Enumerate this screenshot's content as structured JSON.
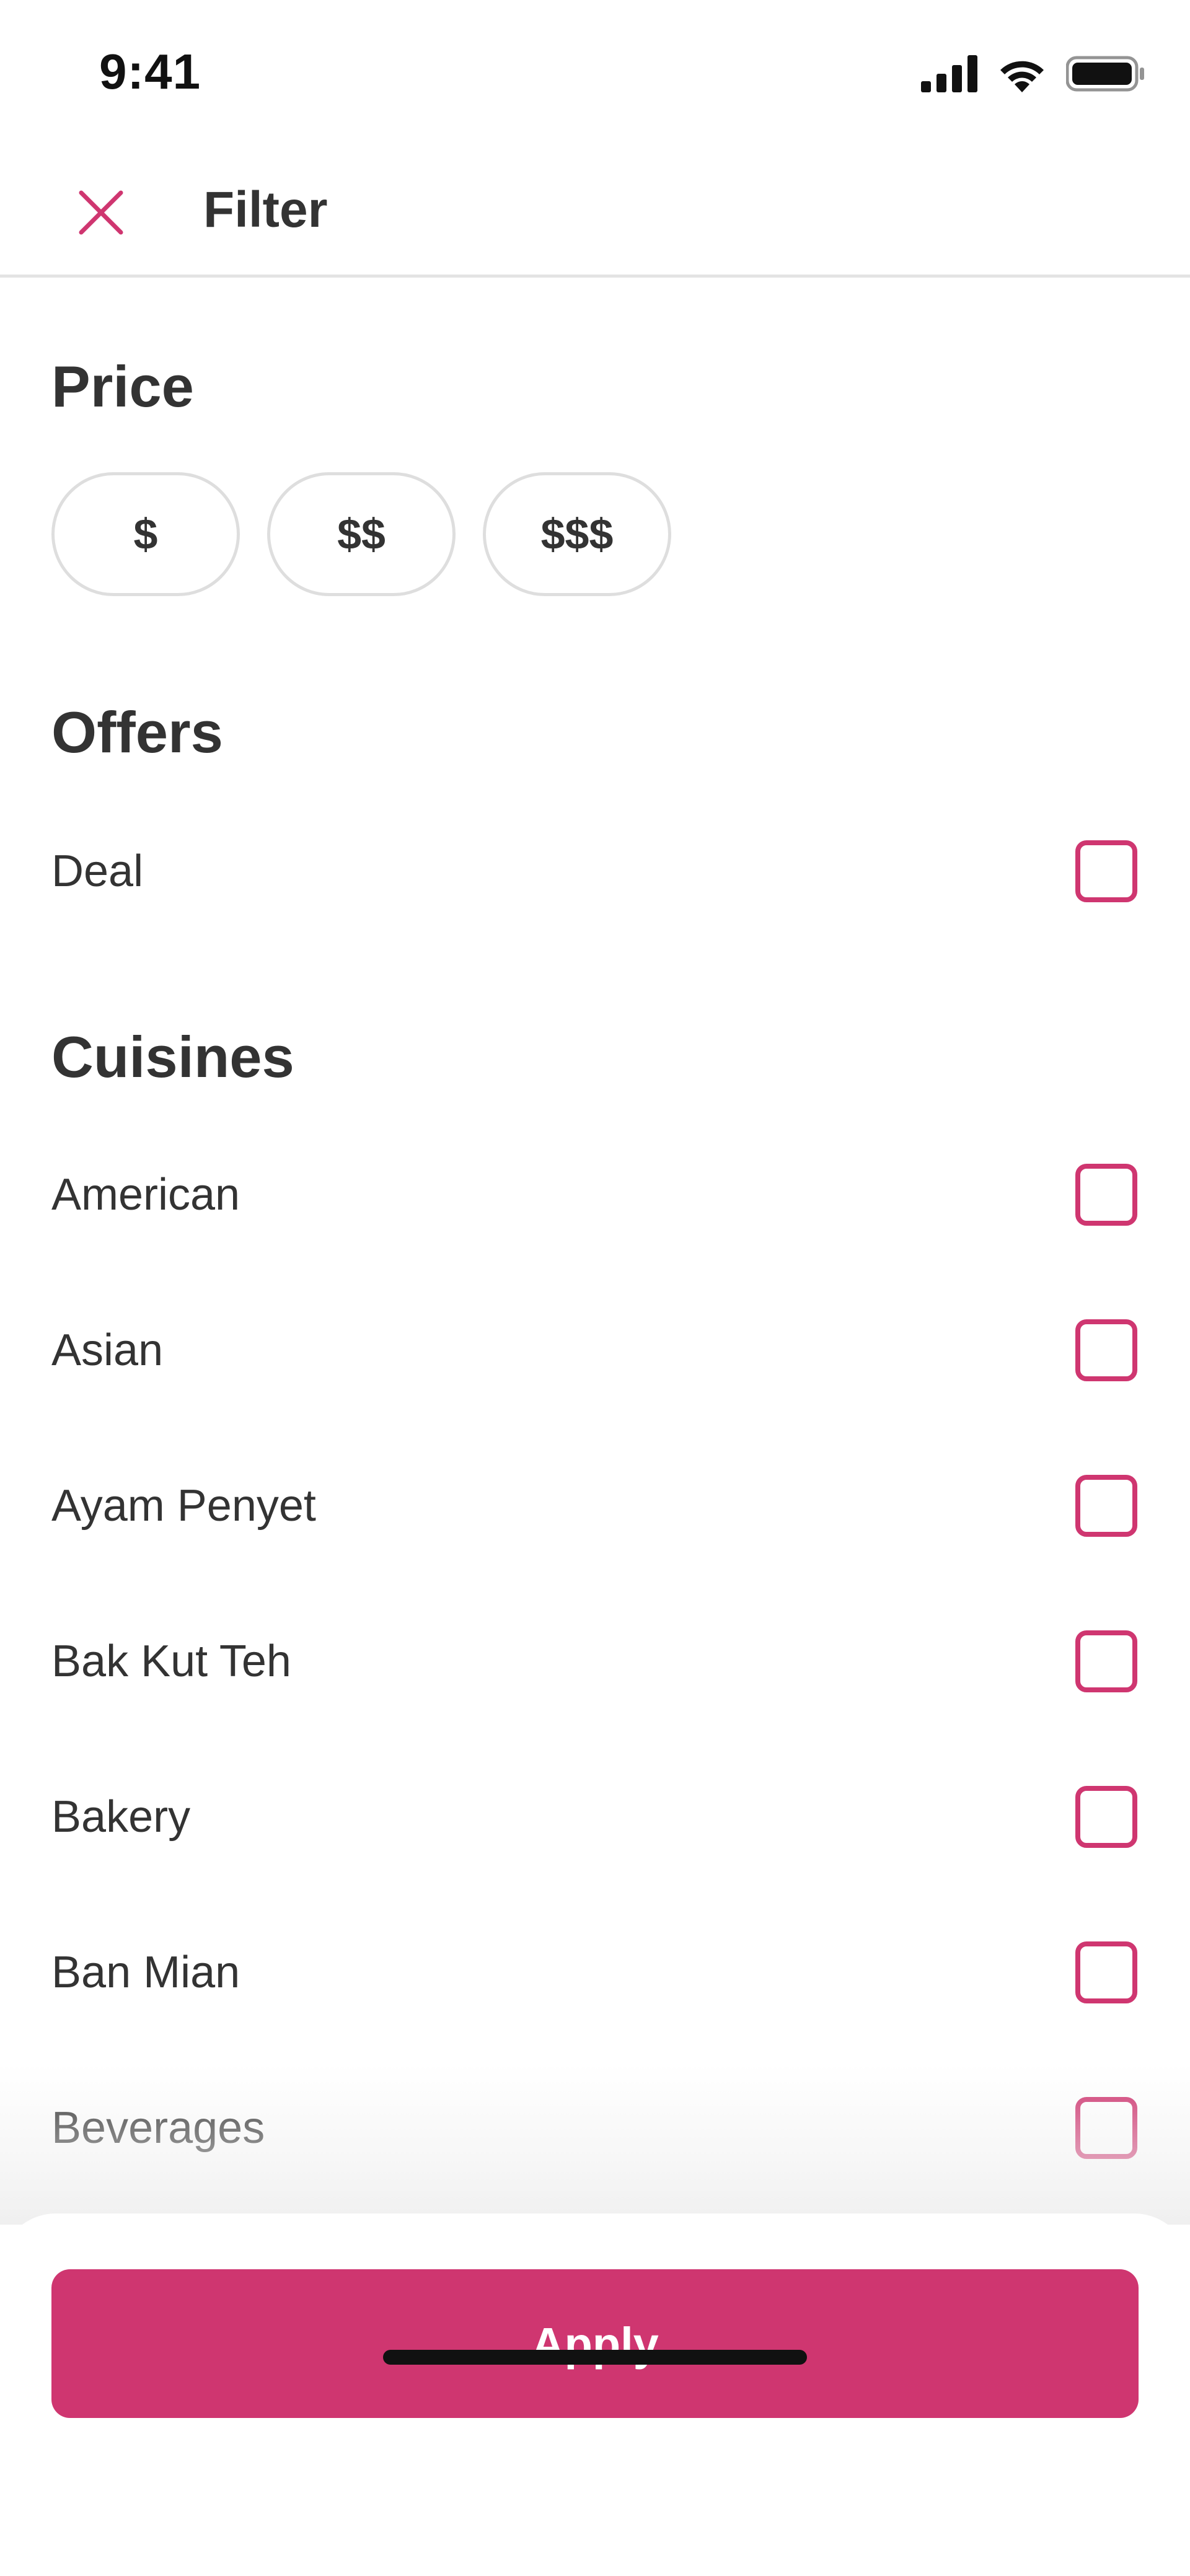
{
  "status_bar": {
    "time": "9:41"
  },
  "header": {
    "title": "Filter",
    "close_icon": "close-icon"
  },
  "price": {
    "title": "Price",
    "options": [
      "$",
      "$$",
      "$$$"
    ]
  },
  "offers": {
    "title": "Offers",
    "items": [
      "Deal"
    ]
  },
  "cuisines": {
    "title": "Cuisines",
    "items": [
      "American",
      "Asian",
      "Ayam Penyet",
      "Bak Kut Teh",
      "Bakery",
      "Ban Mian",
      "Beverages"
    ]
  },
  "footer": {
    "apply_label": "Apply"
  },
  "colors": {
    "accent": "#cf3670",
    "text": "#333333",
    "border": "#dedede"
  }
}
